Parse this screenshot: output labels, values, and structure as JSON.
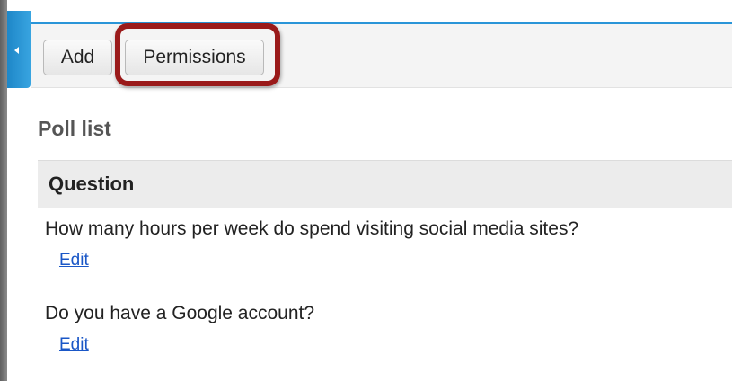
{
  "toolbar": {
    "add_label": "Add",
    "permissions_label": "Permissions"
  },
  "poll_list": {
    "title": "Poll list",
    "column_header": "Question",
    "rows": [
      {
        "question": "How many hours per week do spend visiting social media sites?",
        "action": "Edit"
      },
      {
        "question": "Do you have a Google account?",
        "action": "Edit"
      }
    ]
  },
  "colors": {
    "accent": "#2a95d8",
    "highlight": "#9a1a1a",
    "link": "#1a57c7"
  },
  "icons": {
    "collapse": "triangle-left-icon"
  }
}
